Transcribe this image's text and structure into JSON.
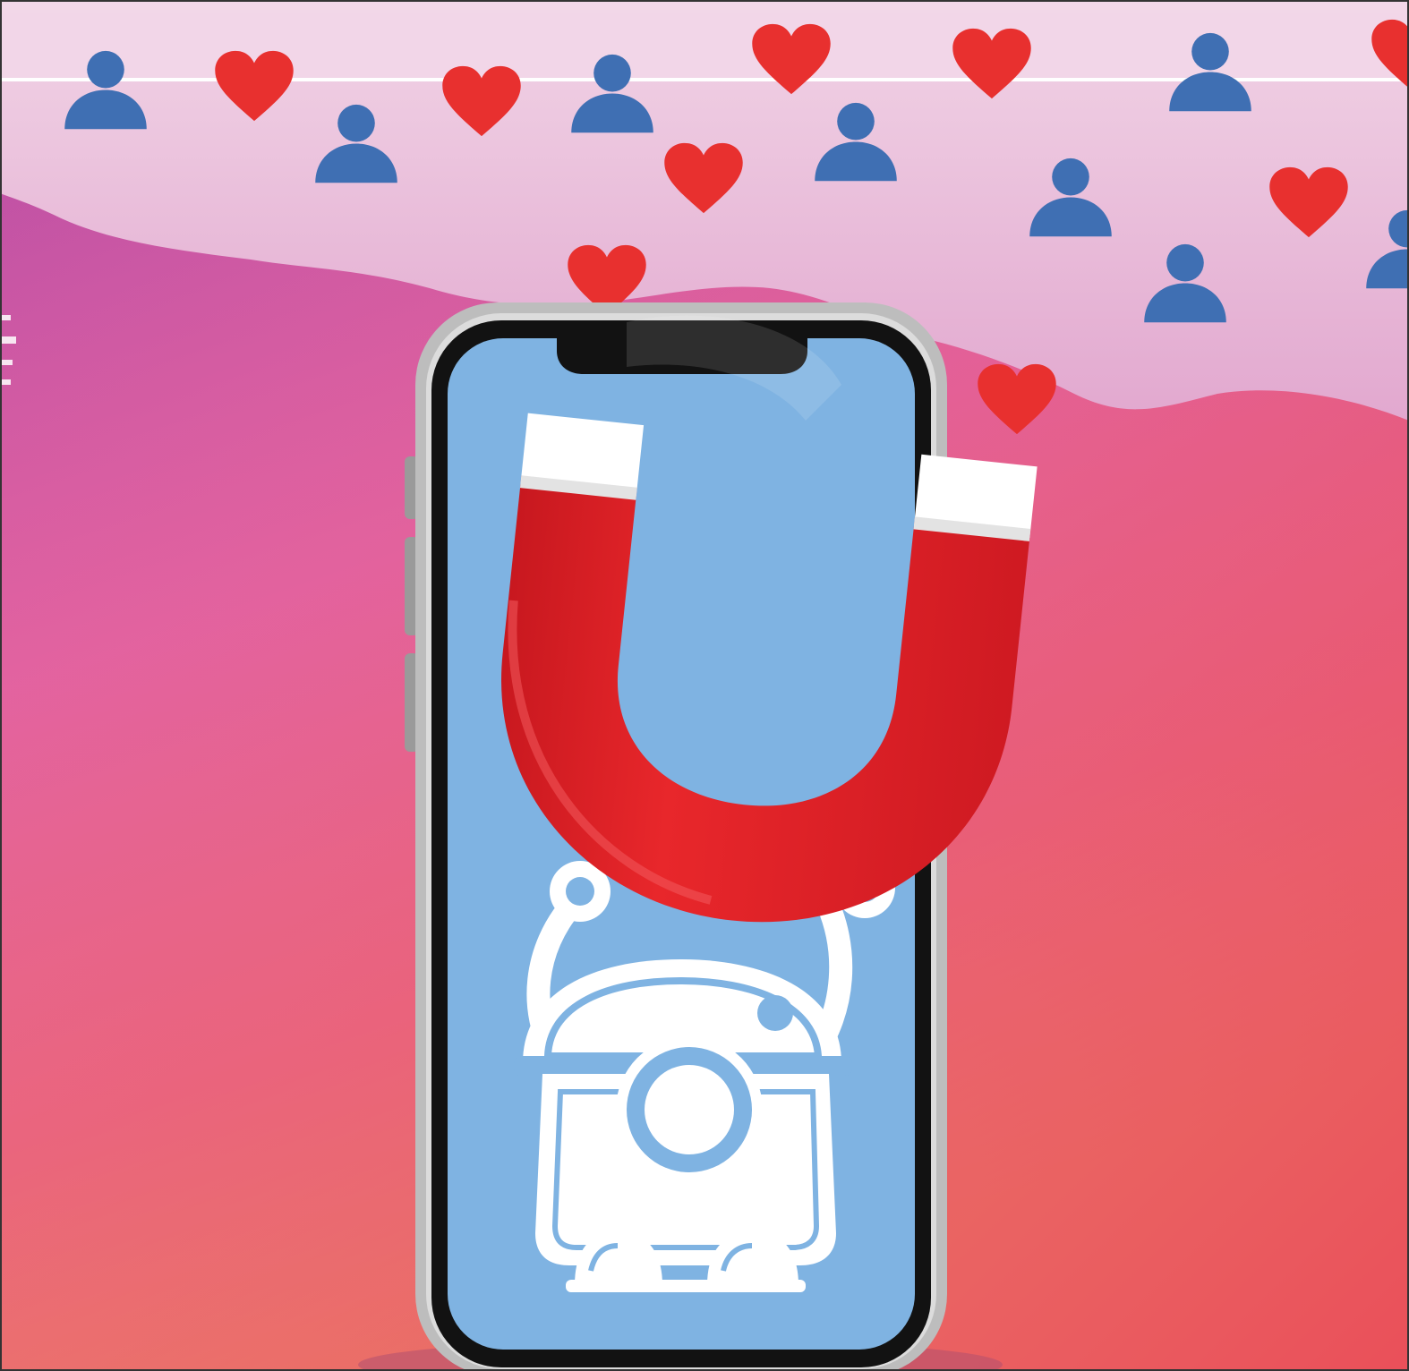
{
  "colors": {
    "background_top": "#b24aa6",
    "background_mid": "#e35f9a",
    "background_bottom": "#f08a4c",
    "background_right": "#e8465e",
    "cloud_band": "#ecc3dc",
    "top_strip": "#f4d9ea",
    "phone_frame": "#b8b8b8",
    "phone_bezel": "#111111",
    "screen": "#7fb3e2",
    "magnet_red": "#e3222b",
    "magnet_tip": "#ffffff",
    "heart": "#e8302f",
    "person": "#3f6fb3",
    "robot": "#ffffff"
  },
  "icons": {
    "heart": "heart-icon",
    "person": "person-icon",
    "magnet": "magnet-icon",
    "robot": "robot-icon",
    "phone": "smartphone-icon"
  }
}
